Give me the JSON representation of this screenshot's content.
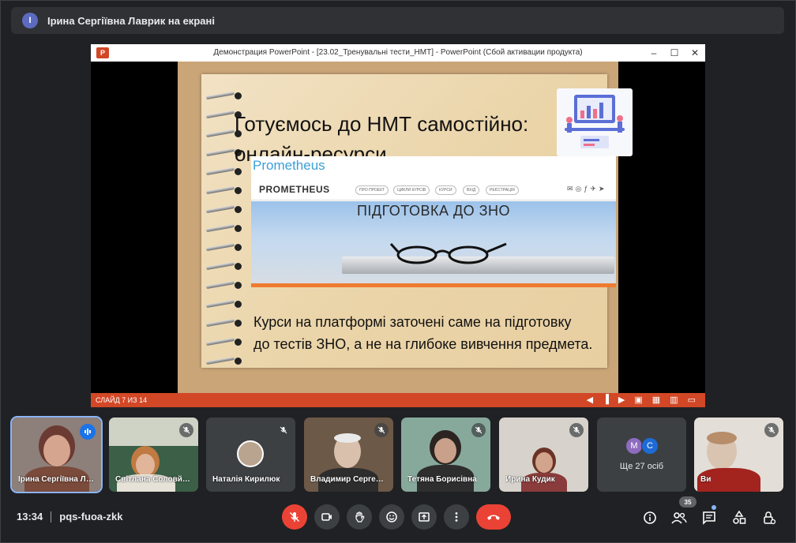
{
  "banner": {
    "avatar_letter": "І",
    "text": "Ірина Сергіївна Лаврик на екрані"
  },
  "ppt": {
    "logo": "P",
    "title": "Демонстрация PowerPoint - [23.02_Тренувальні тести_НМТ] - PowerPoint (Сбой активации продукта)",
    "window_controls": {
      "minimize": "–",
      "maximize": "☐",
      "close": "✕"
    },
    "status": {
      "slide_counter": "СЛАЙД 7 ИЗ 14"
    }
  },
  "slide": {
    "title_line1": "Готуємось до НМТ самостійно:",
    "title_line2": "онлайн-ресурси",
    "prometheus_label": "Prometheus",
    "prometheus_logo": "PROMETHEUS",
    "nav_items": [
      "ПРО ПРОЕКТ",
      "ЦИКЛИ КУРСІВ",
      "КУРСИ",
      "ВХІД",
      "РЕЄСТРАЦІЯ"
    ],
    "hero_text": "ПІДГОТОВКА ДО ЗНО",
    "body_line1": "Курси на платформі заточені саме на підготовку",
    "body_line2": "до тестів ЗНО, а не на глибоке вивчення предмета."
  },
  "participants": [
    {
      "name": "Ірина Сергіївна Лаврик",
      "speaking": true
    },
    {
      "name": "Світлана Соловйова",
      "muted": true
    },
    {
      "name": "Наталія Кирилюк",
      "muted": true
    },
    {
      "name": "Владимир Сергеевич",
      "muted": true
    },
    {
      "name": "Тетяна Борисівна",
      "muted": true
    },
    {
      "name": "Ирина Кудик",
      "muted": true
    },
    {
      "name": "Ще 27 осіб",
      "avatars": [
        "М",
        "С"
      ]
    },
    {
      "name": "Ви",
      "muted": true
    }
  ],
  "bottom": {
    "time": "13:34",
    "meeting_code": "pqs-fuoa-zkk",
    "people_count": "35"
  },
  "colors": {
    "bg": "#202124",
    "tile": "#3c4043",
    "accent": "#8ab4f8",
    "danger": "#ea4335",
    "ppt": "#d24726"
  }
}
